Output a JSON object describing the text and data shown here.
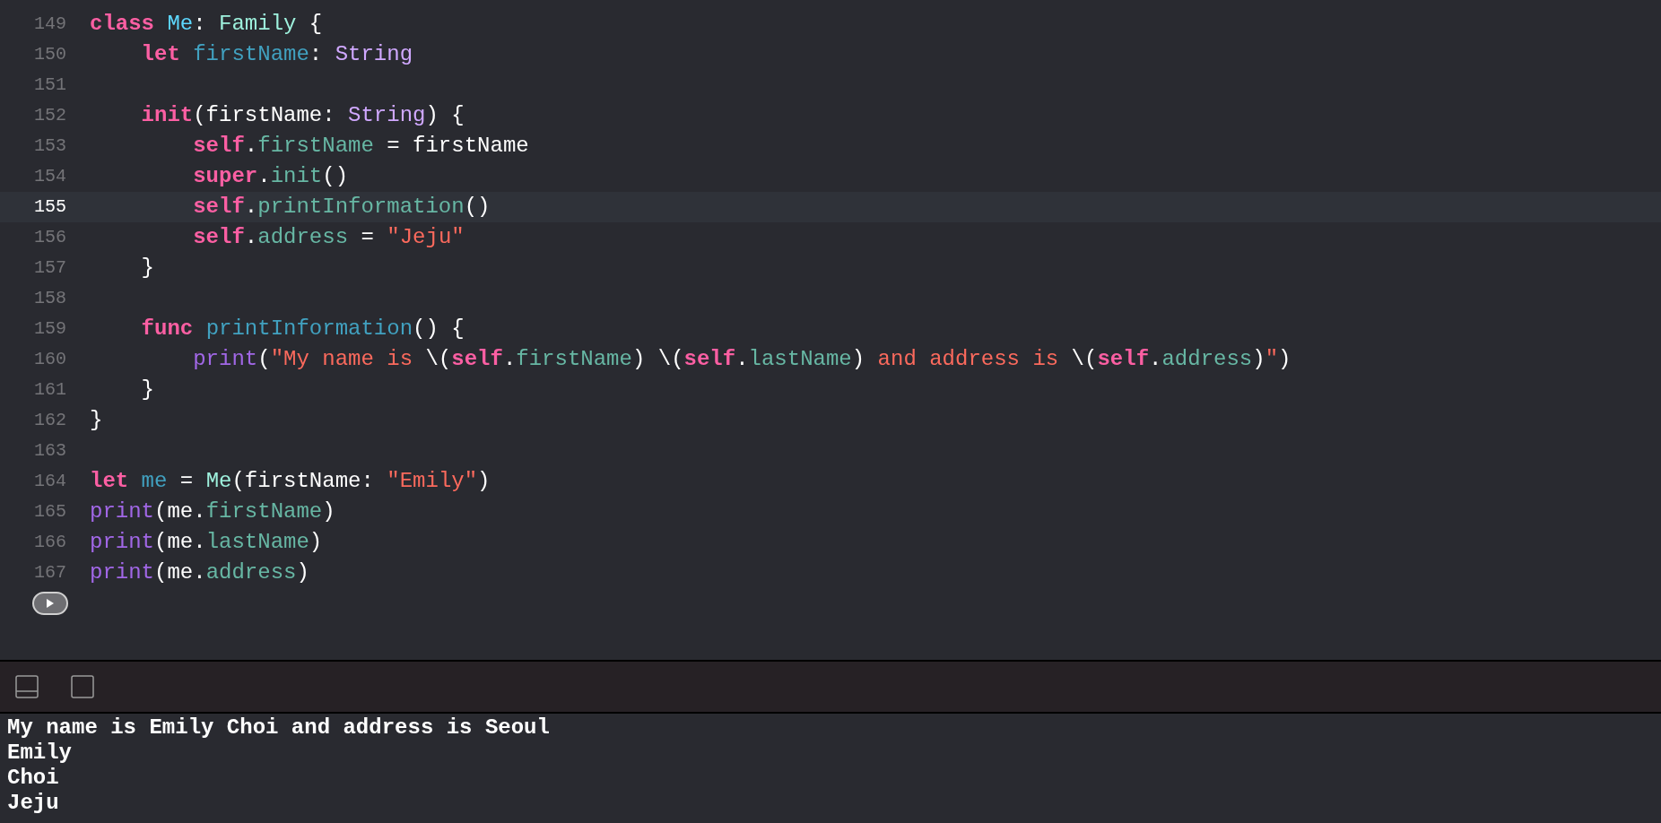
{
  "editor": {
    "lines": [
      {
        "number": "149",
        "highlighted": false,
        "tokens": [
          {
            "text": "class ",
            "kind": "keyword"
          },
          {
            "text": "Me",
            "kind": "class-decl"
          },
          {
            "text": ": ",
            "kind": "plain"
          },
          {
            "text": "Family",
            "kind": "other-type"
          },
          {
            "text": " {",
            "kind": "plain"
          }
        ]
      },
      {
        "number": "150",
        "highlighted": false,
        "tokens": [
          {
            "text": "    let ",
            "kind": "keyword"
          },
          {
            "text": "firstName",
            "kind": "decl"
          },
          {
            "text": ": ",
            "kind": "plain"
          },
          {
            "text": "String",
            "kind": "type"
          }
        ]
      },
      {
        "number": "151",
        "highlighted": false
      },
      {
        "number": "152",
        "highlighted": false,
        "tokens": [
          {
            "text": "    init",
            "kind": "keyword"
          },
          {
            "text": "(firstName: ",
            "kind": "plain"
          },
          {
            "text": "String",
            "kind": "type"
          },
          {
            "text": ") {",
            "kind": "plain"
          }
        ]
      },
      {
        "number": "153",
        "highlighted": false,
        "tokens": [
          {
            "text": "        self",
            "kind": "keyword"
          },
          {
            "text": ".",
            "kind": "plain"
          },
          {
            "text": "firstName",
            "kind": "member"
          },
          {
            "text": " = firstName",
            "kind": "plain"
          }
        ]
      },
      {
        "number": "154",
        "highlighted": false,
        "tokens": [
          {
            "text": "        super",
            "kind": "keyword"
          },
          {
            "text": ".",
            "kind": "plain"
          },
          {
            "text": "init",
            "kind": "member"
          },
          {
            "text": "()",
            "kind": "plain"
          }
        ]
      },
      {
        "number": "155",
        "highlighted": true,
        "tokens": [
          {
            "text": "        self",
            "kind": "keyword"
          },
          {
            "text": ".",
            "kind": "plain"
          },
          {
            "text": "printInformation",
            "kind": "member"
          },
          {
            "text": "()",
            "kind": "plain"
          }
        ]
      },
      {
        "number": "156",
        "highlighted": false,
        "tokens": [
          {
            "text": "        self",
            "kind": "keyword"
          },
          {
            "text": ".",
            "kind": "plain"
          },
          {
            "text": "address",
            "kind": "member"
          },
          {
            "text": " = ",
            "kind": "plain"
          },
          {
            "text": "\"Jeju\"",
            "kind": "string"
          }
        ]
      },
      {
        "number": "157",
        "highlighted": false,
        "tokens": [
          {
            "text": "    }",
            "kind": "plain"
          }
        ]
      },
      {
        "number": "158",
        "highlighted": false
      },
      {
        "number": "159",
        "highlighted": false,
        "tokens": [
          {
            "text": "    func ",
            "kind": "keyword"
          },
          {
            "text": "printInformation",
            "kind": "decl"
          },
          {
            "text": "() {",
            "kind": "plain"
          }
        ]
      },
      {
        "number": "160",
        "highlighted": false,
        "tokens": [
          {
            "text": "        print",
            "kind": "function"
          },
          {
            "text": "(",
            "kind": "plain"
          },
          {
            "text": "\"My name is ",
            "kind": "string"
          },
          {
            "text": "\\(",
            "kind": "plain"
          },
          {
            "text": "self",
            "kind": "keyword"
          },
          {
            "text": ".",
            "kind": "plain"
          },
          {
            "text": "firstName",
            "kind": "member"
          },
          {
            "text": ") \\(",
            "kind": "plain"
          },
          {
            "text": "self",
            "kind": "keyword"
          },
          {
            "text": ".",
            "kind": "plain"
          },
          {
            "text": "lastName",
            "kind": "member"
          },
          {
            "text": ")",
            "kind": "plain"
          },
          {
            "text": " and address is ",
            "kind": "string"
          },
          {
            "text": "\\(",
            "kind": "plain"
          },
          {
            "text": "self",
            "kind": "keyword"
          },
          {
            "text": ".",
            "kind": "plain"
          },
          {
            "text": "address",
            "kind": "member"
          },
          {
            "text": ")",
            "kind": "plain"
          },
          {
            "text": "\"",
            "kind": "string"
          },
          {
            "text": ")",
            "kind": "plain"
          }
        ]
      },
      {
        "number": "161",
        "highlighted": false,
        "tokens": [
          {
            "text": "    }",
            "kind": "plain"
          }
        ]
      },
      {
        "number": "162",
        "highlighted": false,
        "tokens": [
          {
            "text": "}",
            "kind": "plain"
          }
        ]
      },
      {
        "number": "163",
        "highlighted": false
      },
      {
        "number": "164",
        "highlighted": false,
        "tokens": [
          {
            "text": "let ",
            "kind": "keyword"
          },
          {
            "text": "me",
            "kind": "decl"
          },
          {
            "text": " = ",
            "kind": "plain"
          },
          {
            "text": "Me",
            "kind": "other-type"
          },
          {
            "text": "(firstName: ",
            "kind": "plain"
          },
          {
            "text": "\"Emily\"",
            "kind": "string"
          },
          {
            "text": ")",
            "kind": "plain"
          }
        ]
      },
      {
        "number": "165",
        "highlighted": false,
        "tokens": [
          {
            "text": "print",
            "kind": "function"
          },
          {
            "text": "(me.",
            "kind": "plain"
          },
          {
            "text": "firstName",
            "kind": "member"
          },
          {
            "text": ")",
            "kind": "plain"
          }
        ]
      },
      {
        "number": "166",
        "highlighted": false,
        "tokens": [
          {
            "text": "print",
            "kind": "function"
          },
          {
            "text": "(me.",
            "kind": "plain"
          },
          {
            "text": "lastName",
            "kind": "member"
          },
          {
            "text": ")",
            "kind": "plain"
          }
        ]
      },
      {
        "number": "167",
        "highlighted": false,
        "tokens": [
          {
            "text": "print",
            "kind": "function"
          },
          {
            "text": "(me.",
            "kind": "plain"
          },
          {
            "text": "address",
            "kind": "member"
          },
          {
            "text": ")",
            "kind": "plain"
          }
        ]
      }
    ]
  },
  "console": {
    "output": [
      "My name is Emily Choi and address is Seoul",
      "Emily",
      "Choi",
      "Jeju"
    ]
  }
}
